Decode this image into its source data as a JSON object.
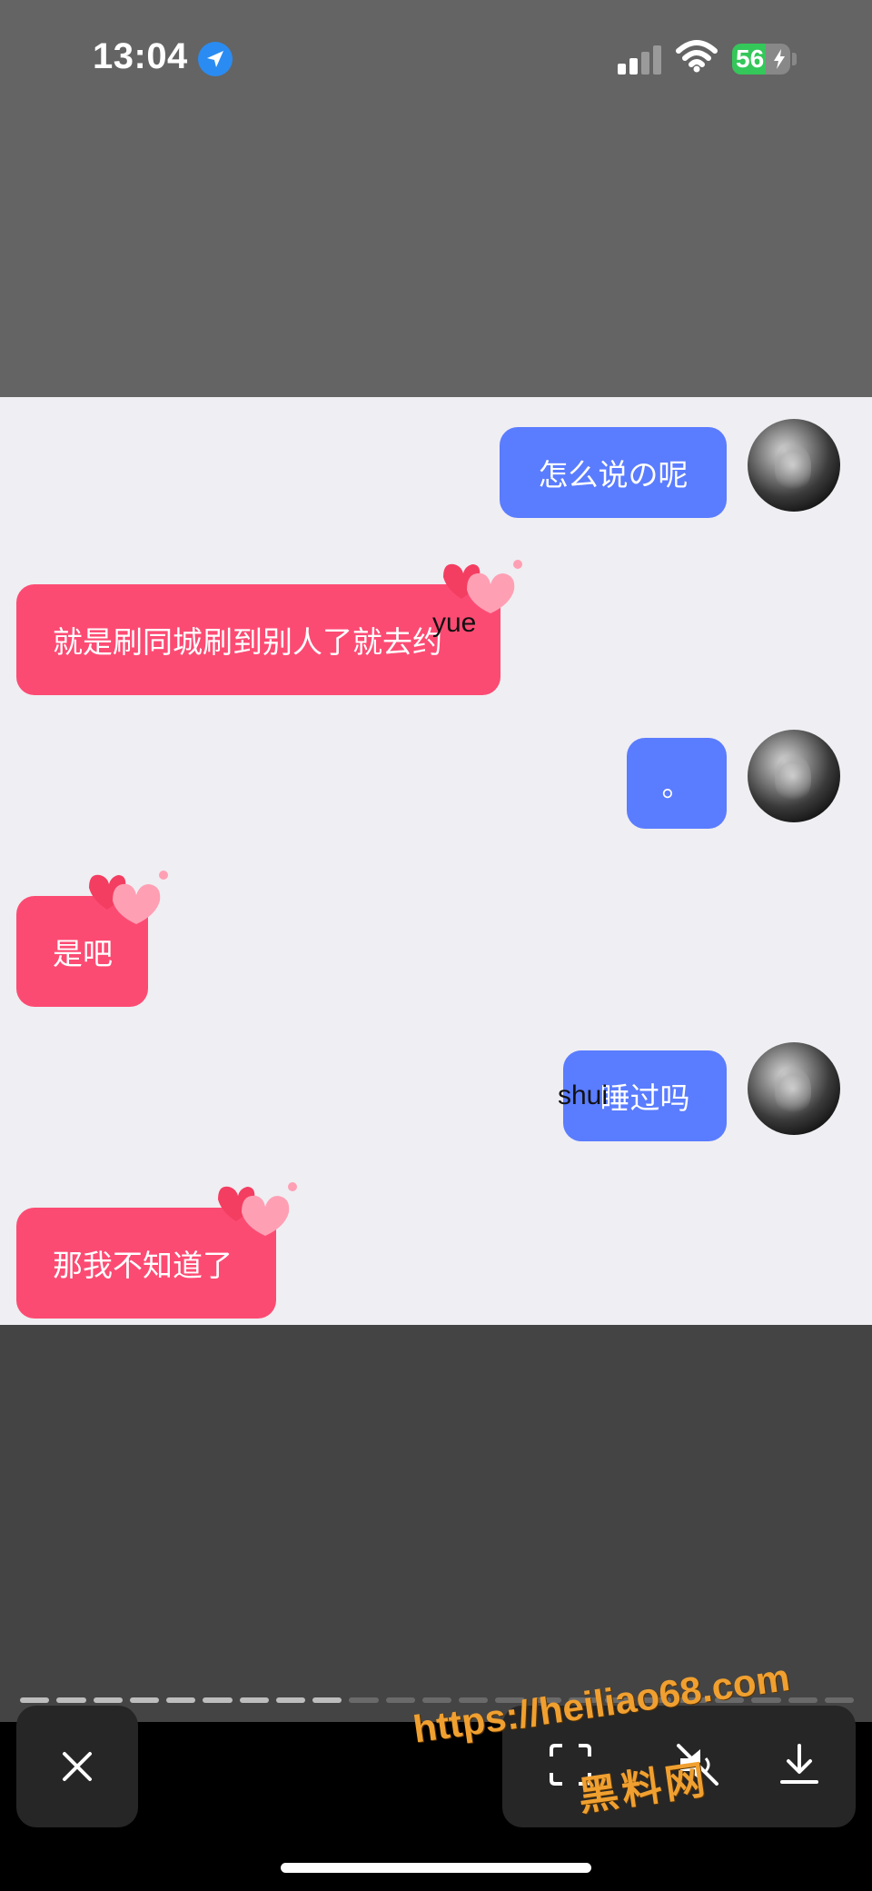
{
  "status_bar": {
    "time": "13:04",
    "battery": "56"
  },
  "messages": [
    {
      "side": "right",
      "color": "blue",
      "text": "怎么说の呢"
    },
    {
      "side": "left",
      "color": "pink",
      "text": "就是刷同城刷到别人了就去约",
      "overlay": "yue"
    },
    {
      "side": "right",
      "color": "blue",
      "text": "。"
    },
    {
      "side": "left",
      "color": "pink",
      "text": "是吧"
    },
    {
      "side": "right",
      "color": "blue",
      "text": "睡过吗",
      "overlay": "shui"
    },
    {
      "side": "left",
      "color": "pink",
      "text": "那我不知道了"
    }
  ],
  "progress": {
    "total": 23,
    "completed": 9
  },
  "toolbar": {
    "close_icon": "close-icon",
    "scan_icon": "scan-icon",
    "mute_icon": "speaker-muted-icon",
    "download_icon": "download-icon"
  },
  "watermark": {
    "url": "https://heiliao68.com",
    "name": "黑料网"
  },
  "colors": {
    "blue_bubble": "#5a7cff",
    "pink_bubble": "#fc4b73",
    "chat_background": "#efeef2"
  }
}
